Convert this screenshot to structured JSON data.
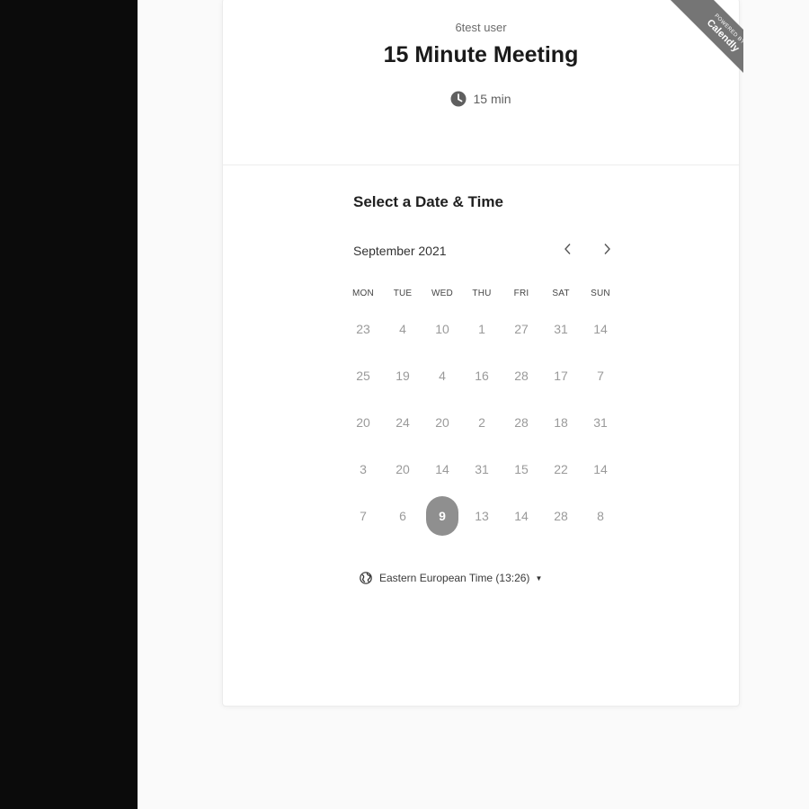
{
  "event": {
    "owner": "6test user",
    "title": "15 Minute Meeting",
    "duration": "15 min"
  },
  "branding": {
    "ribbon_small": "POWERED BY",
    "ribbon_big": "Calendly"
  },
  "calendar": {
    "heading": "Select a Date & Time",
    "month": "September 2021",
    "weekdays": [
      "MON",
      "TUE",
      "WED",
      "THU",
      "FRI",
      "SAT",
      "SUN"
    ],
    "weeks": [
      [
        "23",
        "4",
        "10",
        "1",
        "27",
        "31",
        "14"
      ],
      [
        "25",
        "19",
        "4",
        "16",
        "28",
        "17",
        "7"
      ],
      [
        "20",
        "24",
        "20",
        "2",
        "28",
        "18",
        "31"
      ],
      [
        "3",
        "20",
        "14",
        "31",
        "15",
        "22",
        "14"
      ],
      [
        "7",
        "6",
        "9",
        "13",
        "14",
        "28",
        "8"
      ]
    ],
    "selected": {
      "week": 4,
      "day": 2
    }
  },
  "timezone": {
    "label": "Eastern European Time (13:26)"
  },
  "icons": {
    "clock": "clock-icon",
    "globe": "globe-icon",
    "prev": "chevron-left-icon",
    "next": "chevron-right-icon",
    "caret": "caret-down-icon"
  },
  "colors": {
    "selected_day_bg": "#8f8f8f",
    "ribbon_bg": "#757575",
    "left_panel_bg": "#0b0b0b"
  }
}
